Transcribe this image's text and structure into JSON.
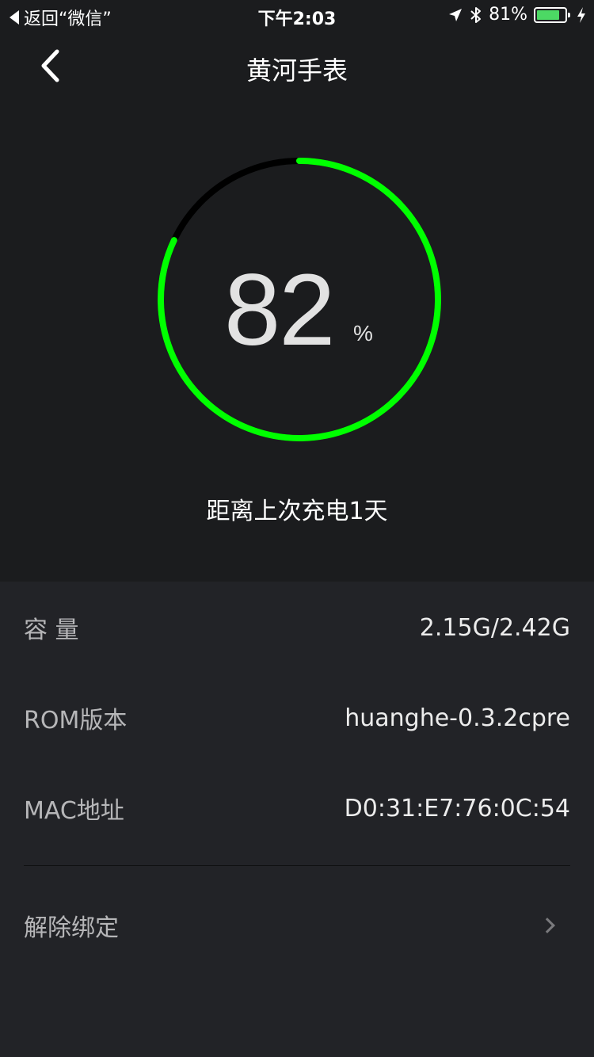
{
  "status_bar": {
    "back_app": "返回“微信”",
    "time": "下午2:03",
    "battery_percent_text": "81%",
    "battery_level": 0.81,
    "battery_color": "#4cd964"
  },
  "nav": {
    "back_icon": "chevron-left-icon",
    "title": "黄河手表"
  },
  "gauge": {
    "value": 82,
    "value_text": "82",
    "unit": "%",
    "progress_color": "#00ff00",
    "track_color": "#000000"
  },
  "since_charge": "距离上次充电1天",
  "info": {
    "capacity_label": "容 量",
    "capacity_value": "2.15G/2.42G",
    "rom_label": "ROM版本",
    "rom_value": "huanghe-0.3.2cpre",
    "mac_label": "MAC地址",
    "mac_value": "D0:31:E7:76:0C:54"
  },
  "unbind": {
    "label": "解除绑定",
    "icon": "chevron-right-icon"
  }
}
